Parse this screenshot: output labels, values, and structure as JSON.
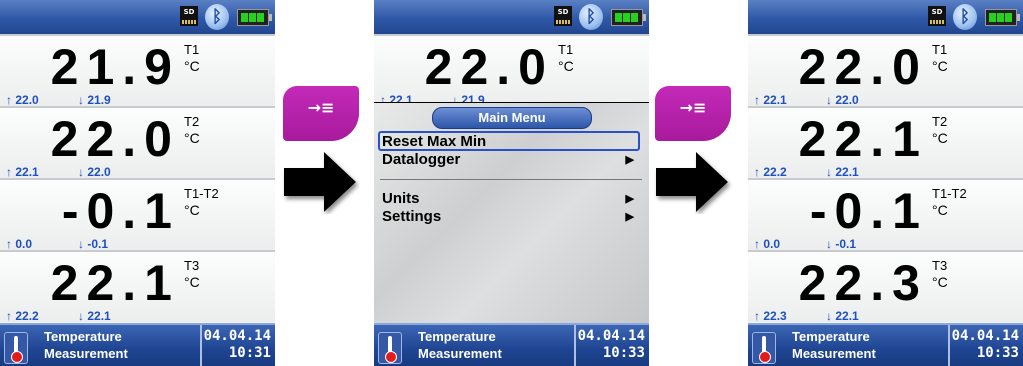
{
  "screens": [
    {
      "channels": [
        {
          "value": "21.9",
          "name": "T1",
          "unit": "°C",
          "max": "22.0",
          "min": "21.9"
        },
        {
          "value": "22.0",
          "name": "T2",
          "unit": "°C",
          "max": "22.1",
          "min": "22.0"
        },
        {
          "value": "-0.1",
          "name": "T1-T2",
          "unit": "°C",
          "max": "0.0",
          "min": "-0.1"
        },
        {
          "value": "22.1",
          "name": "T3",
          "unit": "°C",
          "max": "22.2",
          "min": "22.1"
        }
      ],
      "footer": {
        "line1": "Temperature",
        "line2": "Measurement",
        "date": "04.04.14",
        "time": "10:31"
      }
    },
    {
      "channels": [
        {
          "value": "22.0",
          "name": "T1",
          "unit": "°C",
          "max": "22.1",
          "min": "21.9"
        }
      ],
      "menu": {
        "title": "Main Menu",
        "items": [
          {
            "label": "Reset Max Min",
            "selected": true,
            "submenu": false
          },
          {
            "label": "Datalogger",
            "selected": false,
            "submenu": true
          },
          {
            "label": "Units",
            "selected": false,
            "submenu": true
          },
          {
            "label": "Settings",
            "selected": false,
            "submenu": true
          }
        ]
      },
      "footer": {
        "line1": "Temperature",
        "line2": "Measurement",
        "date": "04.04.14",
        "time": "10:33"
      }
    },
    {
      "channels": [
        {
          "value": "22.0",
          "name": "T1",
          "unit": "°C",
          "max": "22.1",
          "min": "22.0"
        },
        {
          "value": "22.1",
          "name": "T2",
          "unit": "°C",
          "max": "22.2",
          "min": "22.1"
        },
        {
          "value": "-0.1",
          "name": "T1-T2",
          "unit": "°C",
          "max": "0.0",
          "min": "-0.1"
        },
        {
          "value": "22.3",
          "name": "T3",
          "unit": "°C",
          "max": "22.3",
          "min": "22.1"
        }
      ],
      "footer": {
        "line1": "Temperature",
        "line2": "Measurement",
        "date": "04.04.14",
        "time": "10:33"
      }
    }
  ],
  "status_icons": {
    "sd_label": "SD",
    "storage": "sd-card-icon",
    "wireless": "bluetooth-icon",
    "power": "battery-icon"
  },
  "symbols": {
    "max_arrow": "↑",
    "min_arrow": "↓",
    "submenu_arrow": "▶",
    "key_glyph": "→≡",
    "bluetooth_glyph": "ᛒ"
  },
  "colors": {
    "header_blue": "#2f58a8",
    "key_magenta": "#b521a9",
    "minmax_blue": "#1e4fc0",
    "battery_green": "#27d21f"
  }
}
